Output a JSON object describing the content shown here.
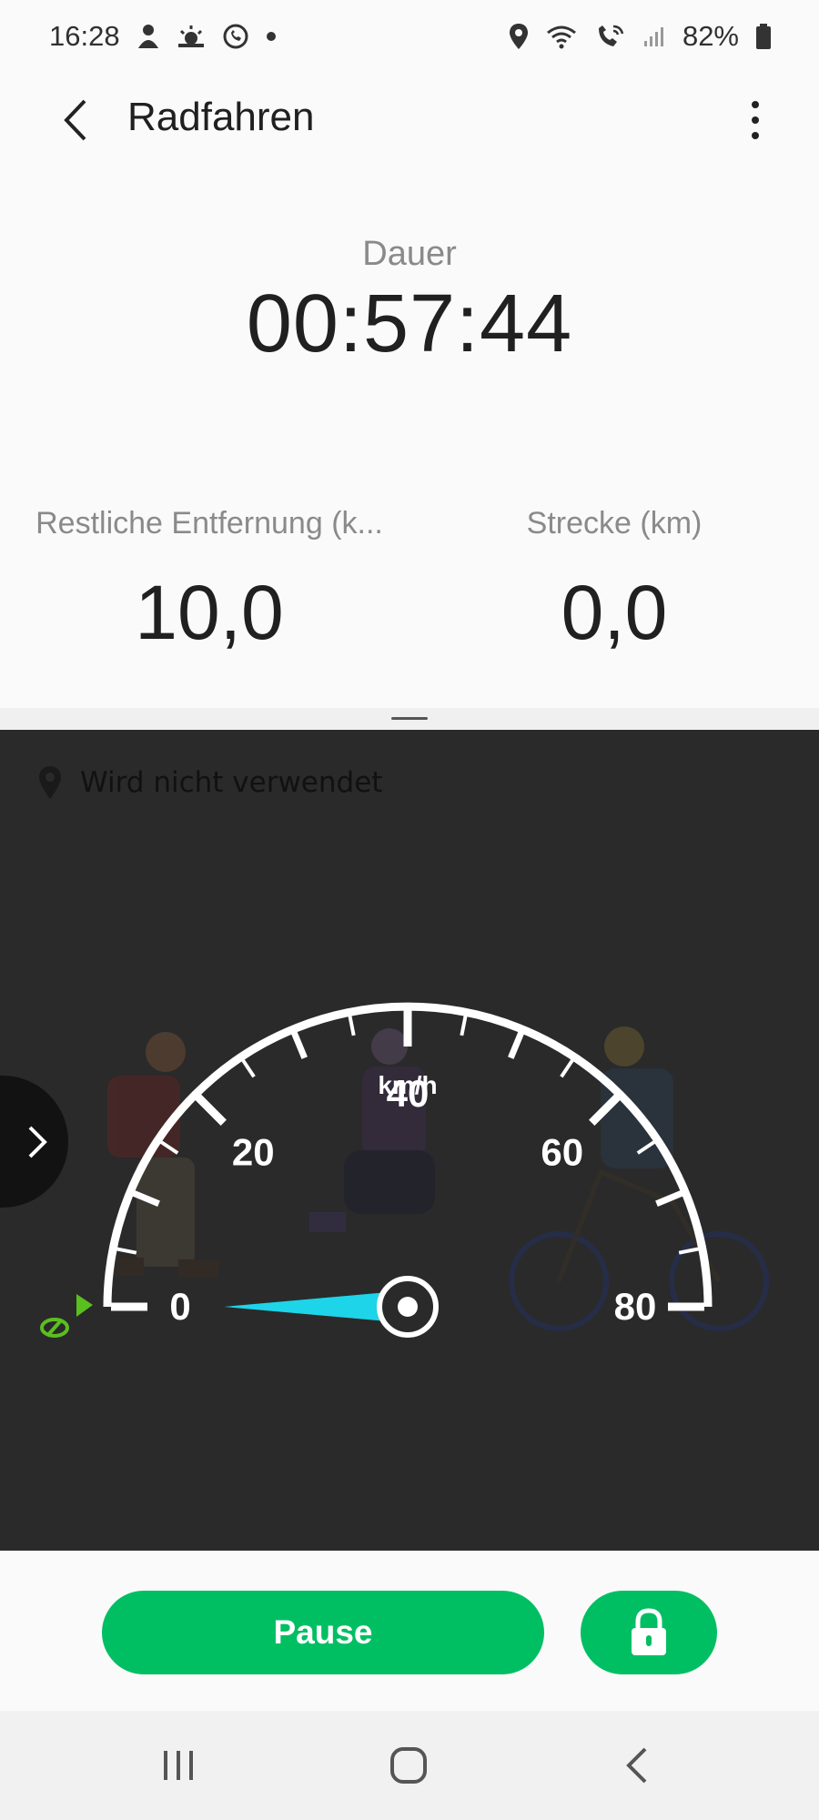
{
  "status_bar": {
    "time": "16:28",
    "battery": "82%",
    "left_icons": [
      "user-badge-icon",
      "sunrise-icon",
      "whatsapp-icon",
      "dot-icon"
    ],
    "right_icons": [
      "location-pin-icon",
      "wifi-icon",
      "wifi-call-icon",
      "signal-icon",
      "battery-icon"
    ]
  },
  "header": {
    "title": "Radfahren"
  },
  "duration": {
    "label": "Dauer",
    "value": "00:57:44"
  },
  "metrics": [
    {
      "label": "Restliche Entfernung (k...",
      "value": "10,0"
    },
    {
      "label": "Strecke (km)",
      "value": "0,0"
    }
  ],
  "map_panel": {
    "location_text": "Wird nicht verwendet"
  },
  "speedometer": {
    "unit": "km/h",
    "min": 0,
    "max": 80,
    "current_speed": 0,
    "major_labels": [
      "0",
      "20",
      "40",
      "60",
      "80"
    ],
    "needle_color": "#1ed4e8",
    "target_marker_color": "#5bbf1f"
  },
  "actions": {
    "pause_label": "Pause",
    "lock_icon": "lock-icon",
    "accent_color": "#00bf63"
  },
  "nav": {
    "icons": [
      "recent-apps-icon",
      "home-icon",
      "back-icon"
    ]
  }
}
